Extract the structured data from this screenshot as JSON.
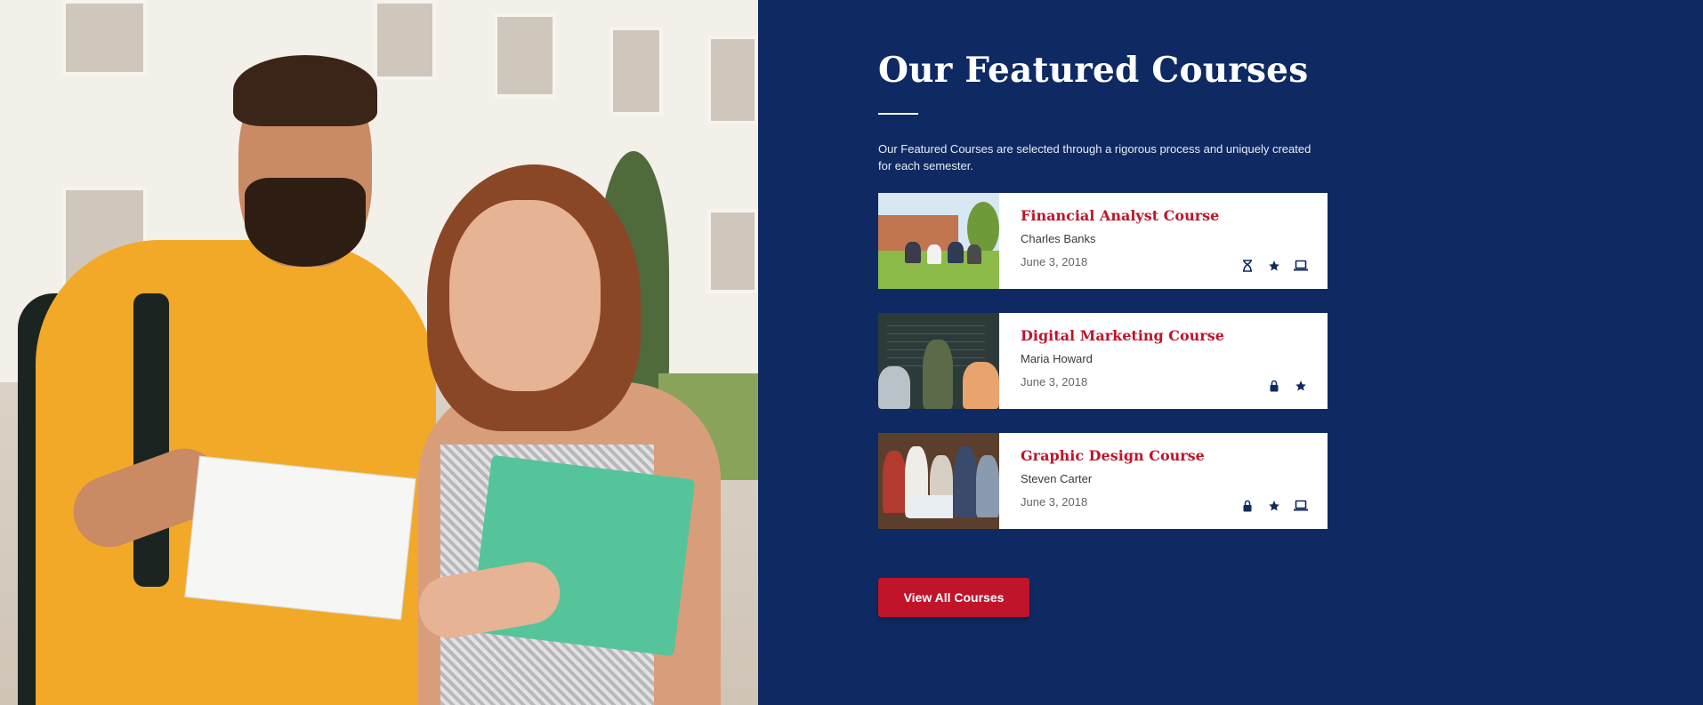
{
  "section": {
    "title": "Our Featured Courses",
    "description": "Our Featured Courses are selected through a rigorous process and uniquely created for each semester."
  },
  "courses": [
    {
      "title": "Financial Analyst Course",
      "instructor": "Charles Banks",
      "date": "June 3, 2018",
      "icons": [
        "hourglass-icon",
        "star-icon",
        "laptop-icon"
      ]
    },
    {
      "title": "Digital Marketing Course",
      "instructor": "Maria Howard",
      "date": "June 3, 2018",
      "icons": [
        "lock-icon",
        "star-icon"
      ]
    },
    {
      "title": "Graphic Design Course",
      "instructor": "Steven Carter",
      "date": "June 3, 2018",
      "icons": [
        "lock-icon",
        "star-icon",
        "laptop-icon"
      ]
    }
  ],
  "cta": {
    "label": "View All Courses"
  },
  "colors": {
    "background": "#0f2a62",
    "accent": "#c0142a",
    "card": "#ffffff",
    "icon": "#0f2a62"
  }
}
